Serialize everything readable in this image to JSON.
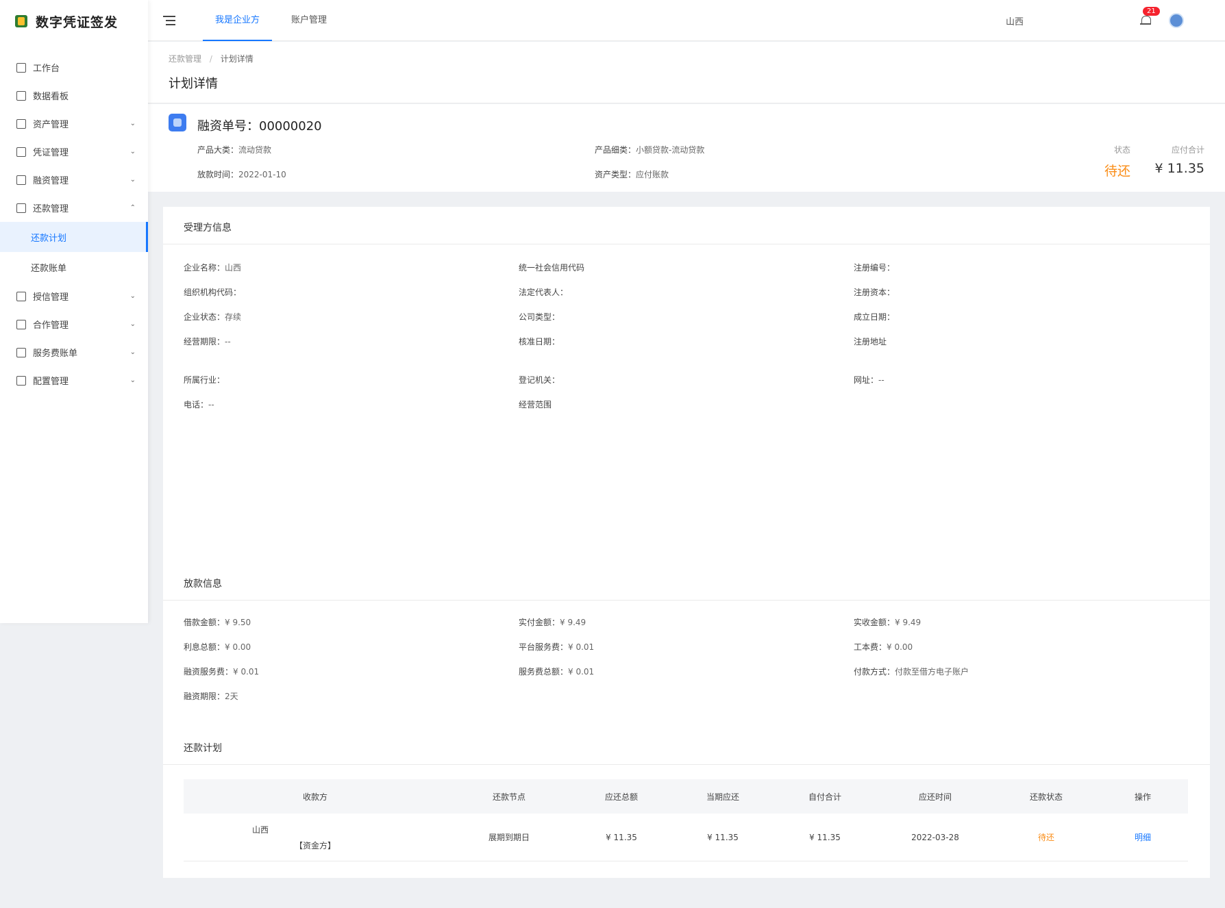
{
  "app": {
    "title": "数字凭证签发"
  },
  "sidebar": {
    "items": [
      {
        "label": "工作台"
      },
      {
        "label": "数据看板"
      },
      {
        "label": "资产管理",
        "chevron": "⌄"
      },
      {
        "label": "凭证管理",
        "chevron": "⌄"
      },
      {
        "label": "融资管理",
        "chevron": "⌄"
      },
      {
        "label": "还款管理",
        "chevron": "⌃"
      },
      {
        "label": "还款计划"
      },
      {
        "label": "还款账单"
      },
      {
        "label": "授信管理",
        "chevron": "⌄"
      },
      {
        "label": "合作管理",
        "chevron": "⌄"
      },
      {
        "label": "服务费账单",
        "chevron": "⌄"
      },
      {
        "label": "配置管理",
        "chevron": "⌄"
      }
    ]
  },
  "topbar": {
    "tabs": [
      {
        "label": "我是企业方"
      },
      {
        "label": "账户管理"
      }
    ],
    "company": "山西",
    "notifications": "21"
  },
  "breadcrumb": {
    "parent": "还款管理",
    "separator": "/",
    "current": "计划详情"
  },
  "page_title": "计划详情",
  "summary": {
    "title": "融资单号：00000020",
    "product_category_label": "产品大类：",
    "product_category": "流动贷款",
    "product_subcategory_label": "产品细类：",
    "product_subcategory": "小额贷款-流动贷款",
    "loan_time_label": "放款时间：",
    "loan_time": "2022-01-10",
    "asset_type_label": "资产类型：",
    "asset_type": "应付账款",
    "status_label": "状态",
    "status": "待还",
    "payable_total_label": "应付合计",
    "payable_total": "¥ 11.35"
  },
  "acceptor": {
    "title": "受理方信息",
    "fields": [
      {
        "label": "企业名称：",
        "value": "山西"
      },
      {
        "label": "统一社会信用代码",
        "value": ""
      },
      {
        "label": "注册编号：",
        "value": ""
      },
      {
        "label": "组织机构代码：",
        "value": ""
      },
      {
        "label": "法定代表人：",
        "value": ""
      },
      {
        "label": "注册资本：",
        "value": ""
      },
      {
        "label": "企业状态：",
        "value": "存续"
      },
      {
        "label": "公司类型：",
        "value": ""
      },
      {
        "label": "成立日期：",
        "value": ""
      },
      {
        "label": "经营期限：",
        "value": "--"
      },
      {
        "label": "核准日期：",
        "value": ""
      },
      {
        "label": "注册地址",
        "value": ""
      },
      {
        "label": "所属行业：",
        "value": ""
      },
      {
        "label": "登记机关：",
        "value": ""
      },
      {
        "label": "网址：",
        "value": "--"
      },
      {
        "label": "电话：",
        "value": "--"
      },
      {
        "label": "经营范围",
        "value": ""
      }
    ]
  },
  "loan": {
    "title": "放款信息",
    "fields": [
      {
        "label": "借款金额：",
        "value": "¥ 9.50"
      },
      {
        "label": "实付金额：",
        "value": "¥ 9.49"
      },
      {
        "label": "实收金额：",
        "value": "¥ 9.49"
      },
      {
        "label": "利息总额：",
        "value": "¥ 0.00"
      },
      {
        "label": "平台服务费：",
        "value": "¥ 0.01"
      },
      {
        "label": "工本费：",
        "value": "¥ 0.00"
      },
      {
        "label": "融资服务费：",
        "value": "¥ 0.01"
      },
      {
        "label": "服务费总额：",
        "value": "¥ 0.01"
      },
      {
        "label": "付款方式：",
        "value": "付款至借方电子账户"
      },
      {
        "label": "融资期限：",
        "value": "2天"
      }
    ]
  },
  "plan": {
    "title": "还款计划",
    "columns": [
      "收款方",
      "还款节点",
      "应还总额",
      "当期应还",
      "自付合计",
      "应还时间",
      "还款状态",
      "操作"
    ],
    "rows": [
      {
        "payee": "山西",
        "payee_role": "【资金方】",
        "node": "展期到期日",
        "total_due": "¥ 11.35",
        "current_due": "¥ 11.35",
        "self_paid": "¥ 11.35",
        "due_date": "2022-03-28",
        "status": "待还",
        "action": "明细"
      }
    ]
  },
  "colors": {
    "primary": "#1677ff",
    "warning": "#fa8c16",
    "badge": "#f5222d"
  }
}
